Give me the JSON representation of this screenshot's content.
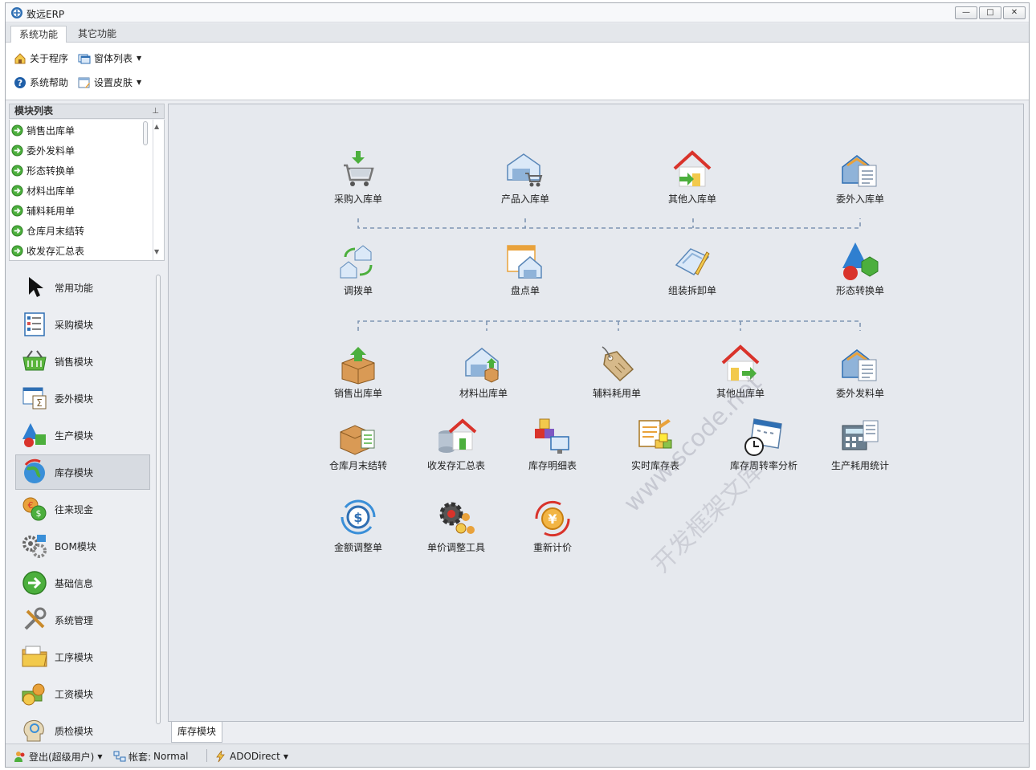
{
  "window": {
    "title": "致远ERP",
    "minimize_label": "—",
    "restore_label": "□",
    "close_label": "✕"
  },
  "tabs": [
    {
      "label": "系统功能",
      "active": true
    },
    {
      "label": "其它功能",
      "active": false
    }
  ],
  "ribbon": {
    "about": "关于程序",
    "window_list": "窗体列表",
    "help": "系统帮助",
    "skin": "设置皮肤"
  },
  "left_panel": {
    "title": "模块列表",
    "pin": "⊥",
    "modules": [
      "销售出库单",
      "委外发料单",
      "形态转换单",
      "材料出库单",
      "辅料耗用单",
      "仓库月末结转",
      "收发存汇总表"
    ],
    "nav": [
      {
        "label": "常用功能",
        "icon": "cursor-icon"
      },
      {
        "label": "采购模块",
        "icon": "list-icon"
      },
      {
        "label": "销售模块",
        "icon": "basket-icon"
      },
      {
        "label": "委外模块",
        "icon": "sheet-icon"
      },
      {
        "label": "生产模块",
        "icon": "shapes-icon"
      },
      {
        "label": "库存模块",
        "icon": "globe-icon",
        "active": true
      },
      {
        "label": "往来现金",
        "icon": "coins-icon"
      },
      {
        "label": "BOM模块",
        "icon": "gears-icon"
      },
      {
        "label": "基础信息",
        "icon": "arrow-circle-icon"
      },
      {
        "label": "系统管理",
        "icon": "tools-icon"
      },
      {
        "label": "工序模块",
        "icon": "folder-icon"
      },
      {
        "label": "工资模块",
        "icon": "money-icon"
      },
      {
        "label": "质检模块",
        "icon": "head-icon"
      }
    ]
  },
  "main": {
    "flow_row1": [
      "采购入库单",
      "产品入库单",
      "其他入库单",
      "委外入库单"
    ],
    "flow_row2": [
      "调拨单",
      "盘点单",
      "组装拆卸单",
      "形态转换单"
    ],
    "flow_row3": [
      "销售出库单",
      "材料出库单",
      "辅料耗用单",
      "其他出库单",
      "委外发料单"
    ],
    "reports_row1": [
      "仓库月末结转",
      "收发存汇总表",
      "库存明细表",
      "实时库存表",
      "库存周转率分析",
      "生产耗用统计"
    ],
    "reports_row2": [
      "金额调整单",
      "单价调整工具",
      "重新计价"
    ],
    "watermark1": "www.scode.net",
    "watermark2": "开发框架文库"
  },
  "bottom_tab": "库存模块",
  "status": {
    "logout": "登出(超级用户)",
    "account_label": "帐套:",
    "account_value": "Normal",
    "driver": "ADODirect"
  }
}
